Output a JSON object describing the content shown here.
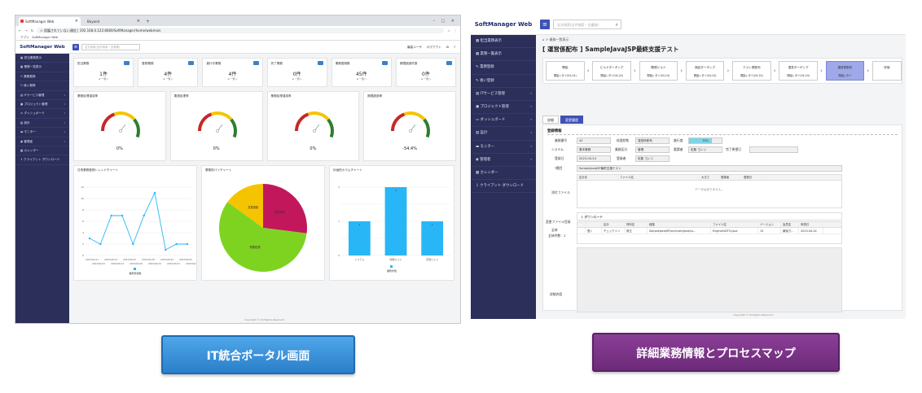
{
  "left": {
    "browser": {
      "tabs": [
        "SoftManager Web",
        "Beyond"
      ],
      "url_warning": "保護されていない通信",
      "url": "192.168.0.122:8080/SoftManager/home/webmain",
      "bookmarks": [
        "アプリ",
        "SoftManager Web"
      ]
    },
    "brand": "SoftManager Web",
    "search_placeholder": "全文検索(全件検索・全業務)",
    "header_right": [
      "最高ユーザ",
      "ログアウト"
    ],
    "sidebar": [
      "担当業務表示",
      "業務一覧表示",
      "業務登録",
      "後い登録",
      "ITサービス管理",
      "プロジェクト管理",
      "ダッシュボード",
      "設計",
      "モニター",
      "管理者",
      "カレンダー",
      "クライアント ダウンロード"
    ],
    "stats": [
      {
        "label": "担当業務",
        "value": "1件",
        "sub": "≡ 一覧へ"
      },
      {
        "label": "登録業務",
        "value": "4件",
        "sub": "≡ 一覧へ"
      },
      {
        "label": "進行中業務",
        "value": "4件",
        "sub": "≡ 一覧へ"
      },
      {
        "label": "完了業務",
        "value": "0件",
        "sub": "≡ 一覧へ"
      },
      {
        "label": "業務登録数",
        "value": "45件",
        "sub": "≡ 一覧へ"
      },
      {
        "label": "期限超過件数",
        "value": "0件",
        "sub": "≡ 一覧へ"
      }
    ],
    "gauges": [
      {
        "title": "業務処理達成率",
        "value": "0%"
      },
      {
        "title": "要員処理率",
        "value": "0%"
      },
      {
        "title": "業務処理達成率",
        "value": "0%"
      },
      {
        "title": "期限超過率",
        "value": "-54.4%"
      }
    ],
    "line_chart_title": "日別業務登録トレンドチャート",
    "pie_chart_title": "業務別パイチャート",
    "bar_chart_title": "計画別カラムチャート",
    "footer": "Copyright © All Rights Reserved."
  },
  "right": {
    "brand": "SoftManager Web",
    "search_placeholder": "全文検索(全件検索・全業務)",
    "sidebar": [
      "担当業務表示",
      "業務一覧表示",
      "業務登録",
      "後い登録",
      "ITサービス管理",
      "プロジェクト管理",
      "ダッシュボード",
      "設計",
      "モニター",
      "管理者",
      "カレンダー",
      "クライアント ダウンロード"
    ],
    "breadcrumb": "業務一覧表示",
    "title": "[ 運営係配布 ] SampleJavaJSP最終支援テスト",
    "process_steps": [
      {
        "name": "開始",
        "date": "開始レタイ(04-24)"
      },
      {
        "name": "ビルドターギング",
        "date": "開始レタイ(04-24)"
      },
      {
        "name": "開発ビルド",
        "date": "開始レタイ(04-24)"
      },
      {
        "name": "検証ターギング",
        "date": "開始レタイ(04-24)"
      },
      {
        "name": "テスト照配布",
        "date": "開始レタイ(04-24)"
      },
      {
        "name": "運営ターギング",
        "date": "開始レタイ(04-24)"
      },
      {
        "name": "運営係配布",
        "date": "開始レタイ"
      },
      {
        "name": "評価",
        "date": ""
      }
    ],
    "tabs": [
      "詳細",
      "変更履歴"
    ],
    "section_title": "登録情報",
    "fields": {
      "business_no_label": "業務番号",
      "business_no": "42",
      "status_label": "処理状態",
      "status": "運営係配布",
      "progress_label": "進行度",
      "progress": "70%",
      "system_label": "システム",
      "system": "基本業務",
      "category_label": "業務区分",
      "category": "管理",
      "requester_label": "要請者",
      "requester": "佐藤 ヨンリ",
      "deadline_label": "完了希望日",
      "reg_date_label": "登録日",
      "reg_date": "2023-04-24",
      "registrant_label": "登録者",
      "registrant": "佐藤 ヨンリ",
      "title_label": "*題目",
      "title_value": "SampleJavaJSP最終支援テスト",
      "attach_label": "添付ファイル",
      "change_label": "変更ファイル目録",
      "total_label": "全体",
      "total_count": "全体件数：2",
      "detail_label": "詳細内容"
    },
    "attach_headers": [
      "区分名",
      "ファイル名",
      "大きさ",
      "登録者",
      "登録日"
    ],
    "attach_empty": "データはありません。",
    "download_label": "ダウンロード",
    "change_headers": [
      "",
      "",
      "区分",
      "資料名",
      "経路",
      "ファイル名",
      "バージョン",
      "会員名",
      "申請日"
    ],
    "change_rows": [
      [
        "",
        "登く",
        "チェックイン",
        "修正",
        "SampleJavaJSP/src/main/java/co...",
        "EngineerDTO.java",
        "15",
        "最後力...",
        "2023-04-24"
      ]
    ],
    "footer": "Copyright © All Rights Reserved."
  },
  "buttons": {
    "left": "IT統合ポータル画面",
    "right": "詳細業務情報とプロセスマップ"
  },
  "chart_data": [
    {
      "type": "line",
      "title": "日別業務登録トレンドチャート",
      "x": [
        "2023/04/11",
        "2023/04/12",
        "2023/04/13",
        "2023/04/14",
        "2023/04/15",
        "2023/04/16",
        "2023/04/18",
        "2023/04/19",
        "2023/04/20",
        "2023/04/21",
        "2023/04/22",
        "2023/04/23"
      ],
      "series": [
        {
          "name": "業務登録数",
          "values": [
            3,
            2,
            7,
            7,
            2,
            7,
            11,
            1,
            2,
            2
          ]
        }
      ],
      "ylim": [
        0,
        12
      ]
    },
    {
      "type": "pie",
      "title": "業務別パイチャート",
      "slices": [
        {
          "label": "業務処理",
          "value": 58,
          "color": "#7ed321"
        },
        {
          "label": "運営変更",
          "value": 27,
          "color": "#c2185b"
        },
        {
          "label": "変更連絡",
          "value": 15,
          "color": "#f5c400"
        }
      ]
    },
    {
      "type": "bar",
      "title": "計画別カラムチャート",
      "categories": [
        "システム",
        "開発ビルド",
        "変更ビルド"
      ],
      "values": [
        1,
        2,
        1
      ],
      "series_name": "業務件数",
      "ylim": [
        0,
        2
      ]
    }
  ]
}
